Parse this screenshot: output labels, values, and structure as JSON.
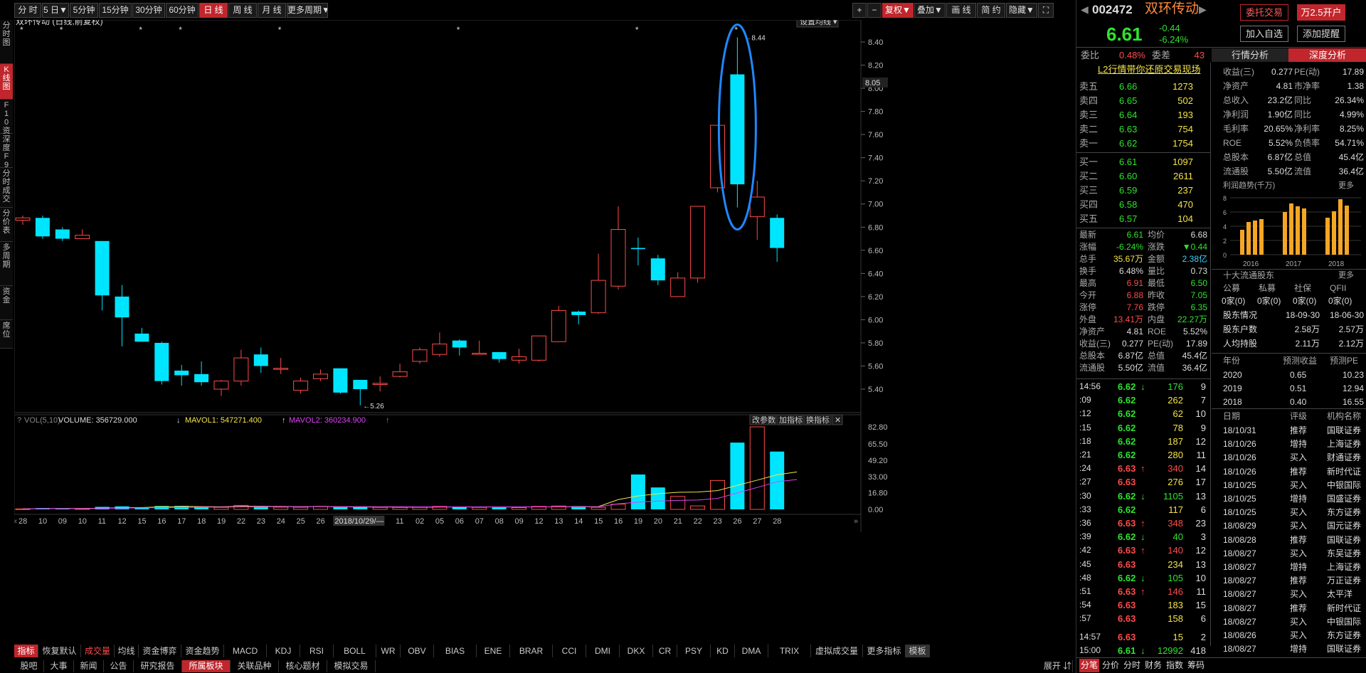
{
  "toolbar": {
    "periods": [
      "分 时",
      "5 日▼",
      "5分钟",
      "15分钟",
      "30分钟",
      "60分钟",
      "日 线",
      "周 线",
      "月 线",
      "更多周期▼"
    ],
    "active_period": 6,
    "right": [
      "+",
      "−",
      "复权▼",
      "叠加▼",
      "画 线",
      "简 约",
      "隐藏▼",
      "⛶"
    ]
  },
  "left_tabs": [
    "分时图",
    "K线图",
    "F10资料",
    "深度F9",
    "分时成交",
    "分价表",
    "多周期",
    "资金",
    "席位"
  ],
  "chart": {
    "title": "双环传动 (日线,前复权)",
    "ma_button": "设置均线 ▾",
    "price_ticks": [
      "8.40",
      "8.20",
      "8.00",
      "7.80",
      "7.60",
      "7.40",
      "7.20",
      "7.00",
      "6.80",
      "6.60",
      "6.40",
      "6.20",
      "6.00",
      "5.80",
      "5.60",
      "5.40"
    ],
    "current_price_tag": "8.05",
    "high_label": "8.44",
    "low_label": "5.26",
    "vol_header": {
      "q": "?",
      "name": "VOL(5,10)",
      "volume": "VOLUME: 356729.000",
      "vol_arrow": "↓",
      "mavol1": "MAVOL1: 547271.400",
      "mavol1_arrow": "↑",
      "mavol2": "MAVOL2: 360234.900",
      "mavol2_arrow": "↑"
    },
    "vol_buttons": [
      "改参数",
      "加指标",
      "换指标",
      "✕"
    ],
    "vol_ticks": [
      "82.80",
      "65.50",
      "49.20",
      "33.00",
      "16.80",
      "0.00"
    ],
    "date_labels": [
      "28",
      "10",
      "09",
      "10",
      "11",
      "12",
      "15",
      "16",
      "17",
      "18",
      "19",
      "22",
      "23",
      "24",
      "25",
      "26",
      "2018/10/29/—",
      "31",
      "11",
      "02",
      "05",
      "06",
      "07",
      "08",
      "09",
      "12",
      "13",
      "14",
      "15",
      "16",
      "19",
      "20",
      "21",
      "22",
      "23",
      "26",
      "27",
      "28"
    ]
  },
  "chart_data": {
    "type": "candlestick",
    "title": "双环传动 (日线,前复权)",
    "ylim": [
      5.26,
      8.44
    ],
    "candles": [
      {
        "o": 6.86,
        "c": 6.88,
        "h": 6.9,
        "l": 6.82
      },
      {
        "o": 6.88,
        "c": 6.72,
        "h": 6.9,
        "l": 6.7
      },
      {
        "o": 6.78,
        "c": 6.7,
        "h": 6.8,
        "l": 6.68
      },
      {
        "o": 6.7,
        "c": 6.73,
        "h": 6.78,
        "l": 6.7
      },
      {
        "o": 6.68,
        "c": 6.21,
        "h": 6.68,
        "l": 6.08
      },
      {
        "o": 6.2,
        "c": 6.02,
        "h": 6.3,
        "l": 5.77
      },
      {
        "o": 5.88,
        "c": 5.81,
        "h": 5.93,
        "l": 5.81
      },
      {
        "o": 5.8,
        "c": 5.47,
        "h": 5.81,
        "l": 5.44
      },
      {
        "o": 5.56,
        "c": 5.52,
        "h": 5.61,
        "l": 5.43
      },
      {
        "o": 5.53,
        "c": 5.46,
        "h": 5.64,
        "l": 5.43
      },
      {
        "o": 5.4,
        "c": 5.47,
        "h": 5.48,
        "l": 5.34
      },
      {
        "o": 5.47,
        "c": 5.67,
        "h": 5.74,
        "l": 5.43
      },
      {
        "o": 5.7,
        "c": 5.6,
        "h": 5.76,
        "l": 5.54
      },
      {
        "o": 5.58,
        "c": 5.58,
        "h": 5.67,
        "l": 5.53
      },
      {
        "o": 5.39,
        "c": 5.47,
        "h": 5.5,
        "l": 5.36
      },
      {
        "o": 5.49,
        "c": 5.53,
        "h": 5.57,
        "l": 5.47
      },
      {
        "o": 5.58,
        "c": 5.37,
        "h": 5.58,
        "l": 5.36
      },
      {
        "o": 5.48,
        "c": 5.4,
        "h": 5.48,
        "l": 5.26
      },
      {
        "o": 5.44,
        "c": 5.45,
        "h": 5.51,
        "l": 5.38
      },
      {
        "o": 5.51,
        "c": 5.55,
        "h": 5.62,
        "l": 5.5
      },
      {
        "o": 5.64,
        "c": 5.74,
        "h": 5.76,
        "l": 5.62
      },
      {
        "o": 5.7,
        "c": 5.79,
        "h": 5.89,
        "l": 5.68
      },
      {
        "o": 5.82,
        "c": 5.76,
        "h": 5.83,
        "l": 5.69
      },
      {
        "o": 5.71,
        "c": 5.71,
        "h": 5.82,
        "l": 5.7
      },
      {
        "o": 5.72,
        "c": 5.66,
        "h": 5.72,
        "l": 5.63
      },
      {
        "o": 5.65,
        "c": 5.68,
        "h": 5.75,
        "l": 5.62
      },
      {
        "o": 5.65,
        "c": 5.86,
        "h": 5.86,
        "l": 5.64
      },
      {
        "o": 5.81,
        "c": 6.08,
        "h": 6.12,
        "l": 5.81
      },
      {
        "o": 6.07,
        "c": 6.04,
        "h": 6.08,
        "l": 5.96
      },
      {
        "o": 6.06,
        "c": 6.34,
        "h": 6.57,
        "l": 6.05
      },
      {
        "o": 6.29,
        "c": 6.78,
        "h": 6.98,
        "l": 6.26
      },
      {
        "o": 6.62,
        "c": 6.61,
        "h": 6.71,
        "l": 6.47
      },
      {
        "o": 6.53,
        "c": 6.34,
        "h": 6.56,
        "l": 6.3
      },
      {
        "o": 6.2,
        "c": 6.36,
        "h": 6.41,
        "l": 6.2
      },
      {
        "o": 6.36,
        "c": 6.98,
        "h": 6.98,
        "l": 6.32
      },
      {
        "o": 7.14,
        "c": 7.68,
        "h": 7.68,
        "l": 7.1
      },
      {
        "o": 8.12,
        "c": 7.17,
        "h": 8.44,
        "l": 6.97
      },
      {
        "o": 6.89,
        "c": 7.06,
        "h": 7.2,
        "l": 6.69
      },
      {
        "o": 6.88,
        "c": 6.62,
        "h": 6.91,
        "l": 6.5
      }
    ],
    "volume": [
      0.5,
      1.3,
      1.0,
      0.8,
      2.5,
      3.0,
      2.0,
      3.4,
      3.5,
      2.2,
      2.0,
      4.0,
      3.3,
      2.2,
      2.1,
      3.0,
      2.4,
      2.3,
      2.0,
      2.0,
      2.1,
      3.0,
      2.8,
      2.0,
      2.0,
      1.8,
      3.0,
      3.4,
      3.2,
      2.0,
      5.2,
      35.0,
      22.0,
      13.0,
      3.5,
      29.0,
      67.0,
      82.8,
      58.0,
      36.0
    ],
    "mavol1": [
      0.5,
      0.8,
      0.9,
      0.9,
      1.2,
      1.7,
      1.9,
      2.5,
      2.9,
      2.8,
      2.6,
      3.0,
      3.0,
      2.9,
      2.7,
      2.9,
      2.6,
      2.4,
      2.4,
      2.3,
      2.2,
      2.3,
      2.4,
      2.4,
      2.4,
      2.4,
      2.5,
      2.6,
      2.7,
      2.8,
      9.8,
      13.5,
      15.7,
      17.1,
      17.4,
      18.8,
      24.1,
      29.3,
      34.7,
      37.6,
      45.0,
      55.0
    ],
    "mavol2": [
      0.5,
      0.7,
      0.8,
      0.8,
      1.0,
      1.3,
      1.5,
      1.8,
      2.0,
      2.2,
      2.3,
      2.5,
      2.6,
      2.7,
      2.7,
      2.8,
      2.7,
      2.7,
      2.6,
      2.6,
      2.5,
      2.5,
      2.5,
      2.5,
      2.5,
      2.5,
      2.5,
      2.5,
      2.5,
      2.6,
      5.6,
      7.2,
      8.3,
      9.0,
      9.4,
      11.0,
      16.5,
      22.0,
      27.7,
      30.0,
      34.0,
      36.0
    ]
  },
  "bottom_tabs": [
    "指标",
    "恢复默认",
    "成交量",
    "均线",
    "资金博弈",
    "资金趋势",
    "MACD",
    "KDJ",
    "RSI",
    "BOLL",
    "WR",
    "OBV",
    "BIAS",
    "ENE",
    "BRAR",
    "CCI",
    "DMI",
    "DKX",
    "CR",
    "PSY",
    "KD",
    "DMA",
    "TRIX",
    "虚拟成交量",
    "更多指标",
    "模板"
  ],
  "footer_tabs": [
    "股吧",
    "大事",
    "新闻",
    "公告",
    "研究报告",
    "所属板块",
    "关联品种",
    "核心题材",
    "模拟交易"
  ],
  "footer_right": "展开 ⇵",
  "stock": {
    "code": "002472",
    "name": "双环传动",
    "price": "6.61",
    "change": "-0.44",
    "pct": "-6.24%",
    "btn_trade": "委托交易",
    "btn_open": "万2.5开户",
    "btn_watch": "加入自选",
    "btn_alert": "添加提醒",
    "webi_label": "委比",
    "webi": "0.48%",
    "weicha_label": "委差",
    "weicha": "43",
    "l2_banner": "L2行情带你还原交易现场",
    "tab_a": "行情分析",
    "tab_b": "深度分析"
  },
  "orderbook": {
    "sell": [
      [
        "卖五",
        "6.66",
        "1273"
      ],
      [
        "卖四",
        "6.65",
        "502"
      ],
      [
        "卖三",
        "6.64",
        "193"
      ],
      [
        "卖二",
        "6.63",
        "754"
      ],
      [
        "卖一",
        "6.62",
        "1754"
      ]
    ],
    "buy": [
      [
        "买一",
        "6.61",
        "1097"
      ],
      [
        "买二",
        "6.60",
        "2611"
      ],
      [
        "买三",
        "6.59",
        "237"
      ],
      [
        "买四",
        "6.58",
        "470"
      ],
      [
        "买五",
        "6.57",
        "104"
      ]
    ]
  },
  "quote": [
    [
      "最新",
      "6.61",
      "均价",
      "6.68"
    ],
    [
      "涨幅",
      "-6.24%",
      "涨跌",
      "▼0.44"
    ],
    [
      "总手",
      "35.67万",
      "金额",
      "2.38亿"
    ],
    [
      "换手",
      "6.48%",
      "量比",
      "0.73"
    ],
    [
      "最高",
      "6.91",
      "最低",
      "6.50"
    ],
    [
      "今开",
      "6.88",
      "昨收",
      "7.05"
    ],
    [
      "涨停",
      "7.76",
      "跌停",
      "6.35"
    ],
    [
      "外盘",
      "13.41万",
      "内盘",
      "22.27万"
    ],
    [
      "净资产",
      "4.81",
      "ROE",
      "5.52%"
    ],
    [
      "收益(三)",
      "0.277",
      "PE(动)",
      "17.89"
    ],
    [
      "总股本",
      "6.87亿",
      "总值",
      "45.4亿"
    ],
    [
      "流通股",
      "5.50亿",
      "流值",
      "36.4亿"
    ]
  ],
  "ticks": [
    [
      "14:56",
      "6.62",
      "↓",
      "176",
      "9"
    ],
    [
      ":09",
      "6.62",
      "",
      "262",
      "7"
    ],
    [
      ":12",
      "6.62",
      "",
      "62",
      "10"
    ],
    [
      ":15",
      "6.62",
      "",
      "78",
      "9"
    ],
    [
      ":18",
      "6.62",
      "",
      "187",
      "12"
    ],
    [
      ":21",
      "6.62",
      "",
      "280",
      "11"
    ],
    [
      ":24",
      "6.63",
      "↑",
      "340",
      "14"
    ],
    [
      ":27",
      "6.63",
      "",
      "276",
      "17"
    ],
    [
      ":30",
      "6.62",
      "↓",
      "1105",
      "13"
    ],
    [
      ":33",
      "6.62",
      "",
      "117",
      "6"
    ],
    [
      ":36",
      "6.63",
      "↑",
      "348",
      "23"
    ],
    [
      ":39",
      "6.62",
      "↓",
      "40",
      "3"
    ],
    [
      ":42",
      "6.63",
      "↑",
      "140",
      "12"
    ],
    [
      ":45",
      "6.63",
      "",
      "234",
      "13"
    ],
    [
      ":48",
      "6.62",
      "↓",
      "105",
      "10"
    ],
    [
      ":51",
      "6.63",
      "↑",
      "146",
      "11"
    ],
    [
      ":54",
      "6.63",
      "",
      "183",
      "15"
    ],
    [
      ":57",
      "6.63",
      "",
      "158",
      "6"
    ],
    [
      "14:57",
      "6.63",
      "",
      "15",
      "2"
    ],
    [
      "15:00",
      "6.61",
      "↓",
      "12992",
      "418"
    ]
  ],
  "fund": [
    [
      "收益(三)",
      "0.277",
      "PE(动)",
      "17.89"
    ],
    [
      "净资产",
      "4.81",
      "市净率",
      "1.38"
    ],
    [
      "总收入",
      "23.2亿",
      "同比",
      "26.34%"
    ],
    [
      "净利润",
      "1.90亿",
      "同比",
      "4.99%"
    ],
    [
      "毛利率",
      "20.65%",
      "净利率",
      "8.25%"
    ],
    [
      "ROE",
      "5.52%",
      "负债率",
      "54.71%"
    ],
    [
      "总股本",
      "6.87亿",
      "总值",
      "45.4亿"
    ],
    [
      "流通股",
      "5.50亿",
      "流值",
      "36.4亿"
    ]
  ],
  "profit": {
    "title": "利润趋势(千万)",
    "more": "更多",
    "yticks": [
      "8",
      "6",
      "4",
      "2",
      "0"
    ],
    "years": [
      "2016",
      "2017",
      "2018"
    ],
    "bars": [
      [
        3.5,
        4.6,
        4.8,
        5.0
      ],
      [
        6.0,
        7.2,
        6.8,
        6.5
      ],
      [
        5.2,
        6.1,
        7.8,
        6.9
      ]
    ]
  },
  "holders": {
    "title": "十大流通股东",
    "more": "更多",
    "heads": [
      "公募",
      "私募",
      "社保",
      "QFII"
    ],
    "vals": [
      "0家(0)",
      "0家(0)",
      "0家(0)",
      "0家(0)"
    ],
    "rows": [
      [
        "股东情况",
        "18-09-30",
        "18-06-30"
      ],
      [
        "股东户数",
        "2.58万",
        "2.57万"
      ],
      [
        "人均持股",
        "2.11万",
        "2.12万"
      ]
    ]
  },
  "forecast": {
    "heads": [
      "年份",
      "预测收益",
      "预测PE"
    ],
    "rows": [
      [
        "2020",
        "0.65",
        "10.23"
      ],
      [
        "2019",
        "0.51",
        "12.94"
      ],
      [
        "2018",
        "0.40",
        "16.55"
      ]
    ]
  },
  "ratings": {
    "heads": [
      "日期",
      "评级",
      "机构名称"
    ],
    "rows": [
      [
        "18/10/31",
        "推荐",
        "国联证券"
      ],
      [
        "18/10/26",
        "增持",
        "上海证券"
      ],
      [
        "18/10/26",
        "买入",
        "财通证券"
      ],
      [
        "18/10/26",
        "推荐",
        "新时代证"
      ],
      [
        "18/10/25",
        "买入",
        "中银国际"
      ],
      [
        "18/10/25",
        "增持",
        "国盛证券"
      ],
      [
        "18/10/25",
        "买入",
        "东方证券"
      ],
      [
        "18/08/29",
        "买入",
        "国元证券"
      ],
      [
        "18/08/28",
        "推荐",
        "国联证券"
      ],
      [
        "18/08/27",
        "买入",
        "东吴证券"
      ],
      [
        "18/08/27",
        "增持",
        "上海证券"
      ],
      [
        "18/08/27",
        "推荐",
        "万正证券"
      ],
      [
        "18/08/27",
        "买入",
        "太平洋"
      ],
      [
        "18/08/27",
        "推荐",
        "新时代证"
      ],
      [
        "18/08/27",
        "买入",
        "中银国际"
      ],
      [
        "18/08/26",
        "买入",
        "东方证券"
      ],
      [
        "18/08/27",
        "增持",
        "国联证券"
      ]
    ]
  },
  "rp_footer": [
    "分笔",
    "分价",
    "分时",
    "财务",
    "指数",
    "筹码"
  ],
  "colors": {
    "up": "#ff4a4a",
    "down": "#00e5ff",
    "ma1": "#f5e54a",
    "ma2": "#e040fb",
    "accent": "#c0262c"
  }
}
